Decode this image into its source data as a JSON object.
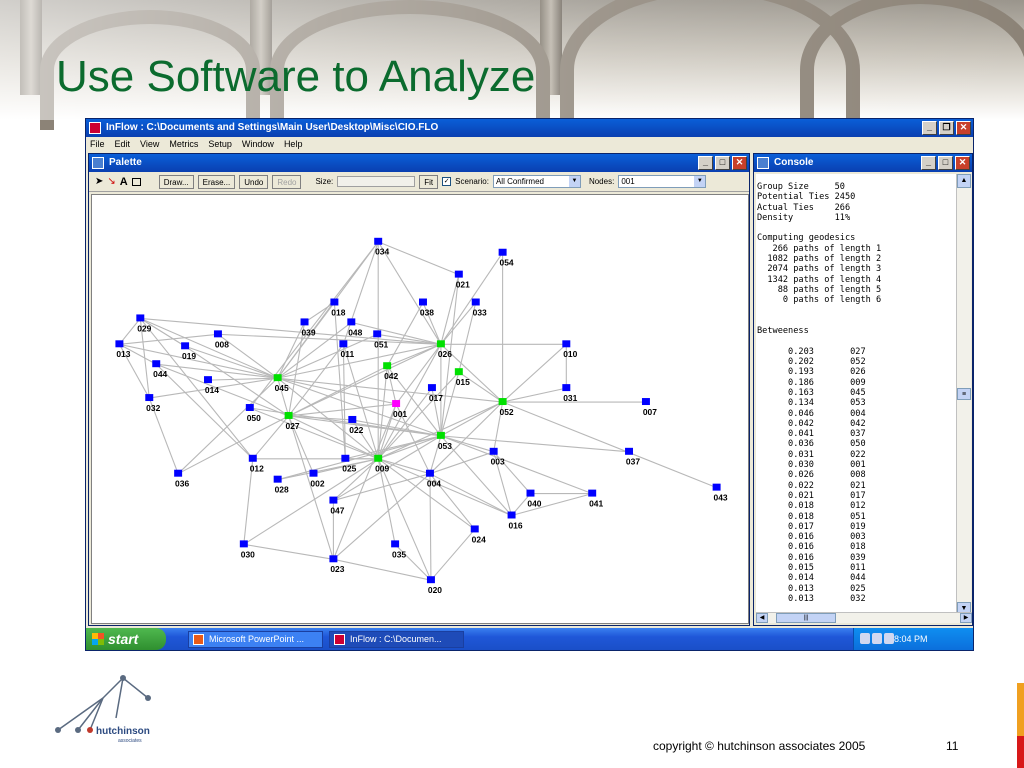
{
  "slide": {
    "title": "Use Software to Analyze",
    "copyright": "copyright © hutchinson associates 2005",
    "page_number": "11",
    "title_color": "#0b6b2e"
  },
  "app": {
    "title": "InFlow : C:\\Documents and Settings\\Main User\\Desktop\\Misc\\CIO.FLO",
    "menu": [
      "File",
      "Edit",
      "View",
      "Metrics",
      "Setup",
      "Window",
      "Help"
    ]
  },
  "palette": {
    "title": "Palette",
    "toolbar": {
      "draw": "Draw...",
      "erase": "Erase...",
      "undo": "Undo",
      "redo": "Redo",
      "size_label": "Size:",
      "fit": "Fit",
      "scenario_label": "Scenario:",
      "scenario_value": "All Confirmed",
      "nodes_label": "Nodes:",
      "nodes_value": "001"
    },
    "node_colors": {
      "default": "#0000ff",
      "highlight": "#00e000",
      "selected": "#ff00ff"
    },
    "nodes": [
      {
        "id": "034",
        "color": "default"
      },
      {
        "id": "054",
        "color": "default"
      },
      {
        "id": "021",
        "color": "default"
      },
      {
        "id": "018",
        "color": "default"
      },
      {
        "id": "038",
        "color": "default"
      },
      {
        "id": "033",
        "color": "default"
      },
      {
        "id": "029",
        "color": "default"
      },
      {
        "id": "039",
        "color": "default"
      },
      {
        "id": "048",
        "color": "default"
      },
      {
        "id": "008",
        "color": "default"
      },
      {
        "id": "051",
        "color": "default"
      },
      {
        "id": "013",
        "color": "default"
      },
      {
        "id": "019",
        "color": "default"
      },
      {
        "id": "011",
        "color": "default"
      },
      {
        "id": "026",
        "color": "highlight"
      },
      {
        "id": "010",
        "color": "default"
      },
      {
        "id": "044",
        "color": "default"
      },
      {
        "id": "042",
        "color": "highlight"
      },
      {
        "id": "014",
        "color": "default"
      },
      {
        "id": "045",
        "color": "highlight"
      },
      {
        "id": "015",
        "color": "highlight"
      },
      {
        "id": "017",
        "color": "default"
      },
      {
        "id": "031",
        "color": "default"
      },
      {
        "id": "032",
        "color": "default"
      },
      {
        "id": "050",
        "color": "default"
      },
      {
        "id": "001",
        "color": "selected"
      },
      {
        "id": "052",
        "color": "highlight"
      },
      {
        "id": "007",
        "color": "default"
      },
      {
        "id": "027",
        "color": "highlight"
      },
      {
        "id": "022",
        "color": "default"
      },
      {
        "id": "053",
        "color": "highlight"
      },
      {
        "id": "012",
        "color": "default"
      },
      {
        "id": "025",
        "color": "default"
      },
      {
        "id": "009",
        "color": "highlight"
      },
      {
        "id": "003",
        "color": "default"
      },
      {
        "id": "037",
        "color": "default"
      },
      {
        "id": "036",
        "color": "default"
      },
      {
        "id": "028",
        "color": "default"
      },
      {
        "id": "002",
        "color": "default"
      },
      {
        "id": "004",
        "color": "default"
      },
      {
        "id": "043",
        "color": "default"
      },
      {
        "id": "047",
        "color": "default"
      },
      {
        "id": "040",
        "color": "default"
      },
      {
        "id": "041",
        "color": "default"
      },
      {
        "id": "016",
        "color": "default"
      },
      {
        "id": "024",
        "color": "default"
      },
      {
        "id": "030",
        "color": "default"
      },
      {
        "id": "035",
        "color": "default"
      },
      {
        "id": "023",
        "color": "default"
      },
      {
        "id": "020",
        "color": "default"
      }
    ]
  },
  "console": {
    "title": "Console",
    "lines": [
      "Group Size     50",
      "Potential Ties 2450",
      "Actual Ties    266",
      "Density        11%",
      "",
      "Computing geodesics",
      "   266 paths of length 1",
      "  1082 paths of length 2",
      "  2074 paths of length 3",
      "  1342 paths of length 4",
      "    88 paths of length 5",
      "     0 paths of length 6",
      "",
      "",
      "Betweeness",
      "",
      "      0.203       027",
      "      0.202       052",
      "      0.193       026",
      "      0.186       009",
      "      0.163       045",
      "      0.134       053",
      "      0.046       004",
      "      0.042       042",
      "      0.041       037",
      "      0.036       050",
      "      0.031       022",
      "      0.030       001",
      "      0.026       008",
      "      0.022       021",
      "      0.021       017",
      "      0.018       012",
      "      0.018       051",
      "      0.017       019",
      "      0.016       003",
      "      0.016       018",
      "      0.016       039",
      "      0.015       011",
      "      0.014       044",
      "      0.013       025",
      "      0.013       032"
    ]
  },
  "taskbar": {
    "start": "start",
    "items": [
      "Microsoft PowerPoint ...",
      "InFlow : C:\\Documen..."
    ],
    "clock": "8:04 PM"
  }
}
